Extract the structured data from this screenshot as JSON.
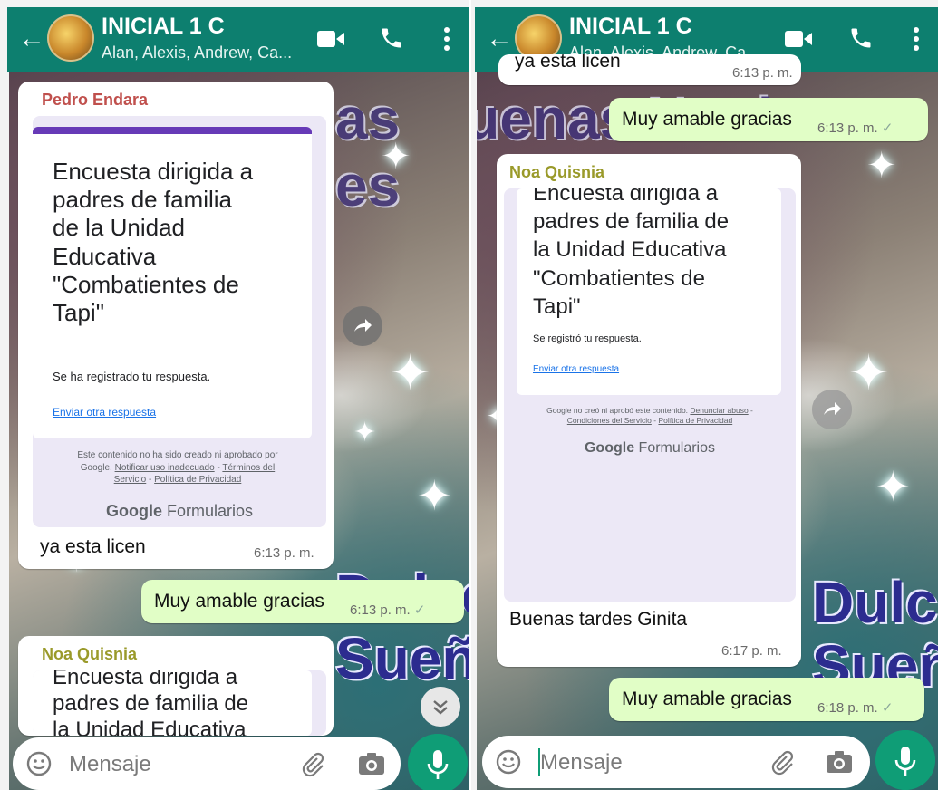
{
  "colors": {
    "header": "#0d7f6f",
    "outgoing": "#e1fec6",
    "incoming": "#ffffff",
    "accent": "#0f9d76",
    "form_purple": "#673ab7",
    "sender_pedro": "#c0504d",
    "sender_noa": "#9a9a2a"
  },
  "header": {
    "title": "INICIAL 1 C",
    "subtitle": "Alan, Alexis, Andrew, Ca...",
    "back_icon": "arrow-left-icon",
    "video_icon": "video-camera-icon",
    "call_icon": "phone-icon",
    "menu_icon": "more-vertical-icon"
  },
  "wallpaper": {
    "text_top": "Buenas Noches",
    "text_bottom1": "Dulces",
    "text_bottom2": "Sueños"
  },
  "form": {
    "title": "Encuesta dirigida a padres de familia de la Unidad Educativa \"Combatientes de Tapi\"",
    "title_lines": [
      "Encuesta dirigida a",
      "padres de familia",
      "de la Unidad",
      "Educativa",
      "\"Combatientes de",
      "Tapi\""
    ],
    "title_lines_right": [
      "Encuesta dirigida a",
      "padres de familia de",
      "la Unidad Educativa",
      "\"Combatientes de",
      "Tapi\""
    ],
    "registered_left": "Se ha registrado tu respuesta.",
    "registered_right": "Se registró tu respuesta.",
    "another_left": "Enviar otra respuesta",
    "another_right": "Enviar otra respuesta",
    "footer_left_1": "Este contenido no ha sido creado ni aprobado por",
    "footer_left_2a": "Google.",
    "footer_left_2b": "Notificar uso inadecuado",
    "footer_left_2c": "Términos del",
    "footer_left_3a": "Servicio",
    "footer_left_3b": "Política de Privacidad",
    "footer_right_1a": "Google no creó ni aprobó este contenido.",
    "footer_right_1b": "Denunciar abuso",
    "footer_right_2a": "Condiciones del Servicio",
    "footer_right_2b": "Política de Privacidad",
    "brand_google": "Google",
    "brand_forms": "Formularios"
  },
  "left": {
    "msg1": {
      "sender": "Pedro Endara",
      "text": "ya esta licen",
      "time": "6:13 p. m."
    },
    "msg2": {
      "text": "Muy amable gracias",
      "time": "6:13 p. m.",
      "check": "✓"
    },
    "msg3": {
      "sender": "Noa Quisnia",
      "preview_1": "Encuesta dirigida a",
      "preview_2": "padres de familia de",
      "preview_3": "la Unidad Educativa"
    }
  },
  "right": {
    "msg0": {
      "text": "ya esta licen",
      "time": "6:13 p. m."
    },
    "msg1": {
      "text": "Muy amable gracias",
      "time": "6:13 p. m.",
      "check": "✓"
    },
    "msg2": {
      "sender": "Noa Quisnia",
      "text": "Buenas tardes Ginita",
      "time": "6:17 p. m."
    },
    "msg3": {
      "text": "Muy amable gracias",
      "time": "6:18 p. m.",
      "check": "✓"
    }
  },
  "input": {
    "placeholder": "Mensaje",
    "emoji_icon": "emoji-icon",
    "attach_icon": "paperclip-icon",
    "camera_icon": "camera-icon",
    "mic_icon": "microphone-icon"
  }
}
